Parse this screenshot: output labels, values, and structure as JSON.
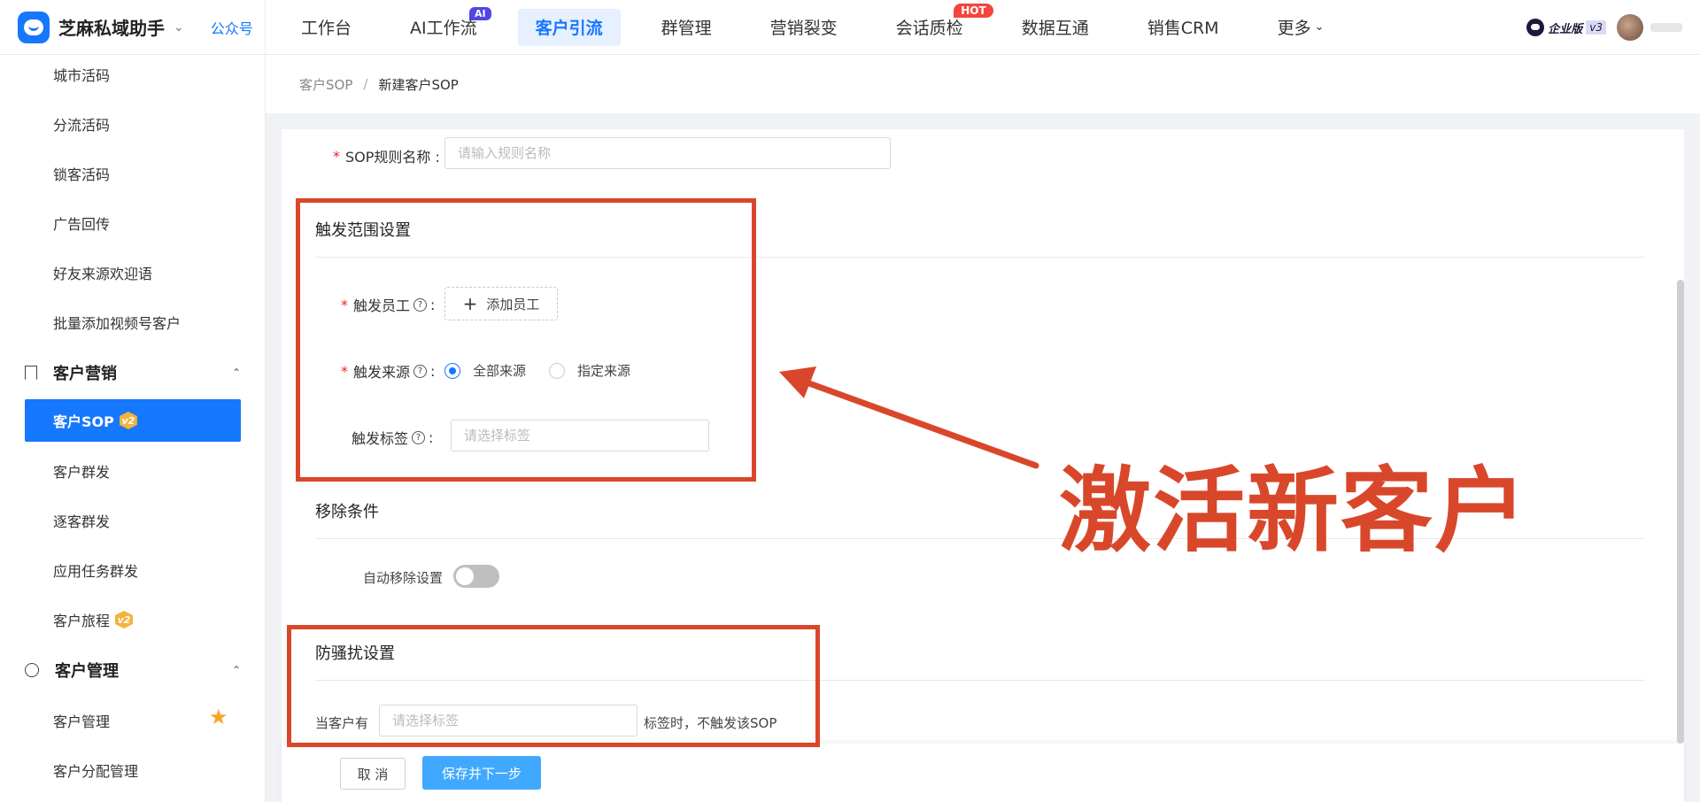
{
  "header": {
    "brand_name": "芝麻私域助手",
    "gzh": "公众号",
    "nav": [
      {
        "label": "工作台"
      },
      {
        "label": "AI工作流",
        "badge": "AI"
      },
      {
        "label": "客户引流",
        "active": true
      },
      {
        "label": "群管理"
      },
      {
        "label": "营销裂变"
      },
      {
        "label": "会话质检",
        "badge": "HOT"
      },
      {
        "label": "数据互通"
      },
      {
        "label": "销售CRM"
      },
      {
        "label": "更多"
      }
    ],
    "edition_label": "企业版",
    "edition_version": "v3"
  },
  "sidebar": {
    "items_top": [
      "城市活码",
      "分流活码",
      "锁客活码",
      "广告回传",
      "好友来源欢迎语",
      "批量添加视频号客户"
    ],
    "group_marketing": "客户营销",
    "active_item": "客户SOP",
    "v2": "v2",
    "items_marketing": [
      "客户群发",
      "逐客群发",
      "应用任务群发",
      "客户旅程"
    ],
    "group_manage": "客户管理",
    "items_manage": [
      "客户管理",
      "客户分配管理"
    ]
  },
  "breadcrumb": {
    "parent": "客户SOP",
    "separator": "/",
    "current": "新建客户SOP"
  },
  "form": {
    "rule_name_label": "SOP规则名称 :",
    "rule_name_placeholder": "请输入规则名称",
    "section_trigger": "触发范围设置",
    "trigger_staff_label": "触发员工",
    "add_staff": "添加员工",
    "trigger_source_label": "触发来源",
    "source_all": "全部来源",
    "source_specified": "指定来源",
    "trigger_tag_label": "触发标签",
    "tag_placeholder": "请选择标签",
    "section_remove": "移除条件",
    "auto_remove_label": "自动移除设置",
    "section_antidisturb": "防骚扰设置",
    "when_customer_has": "当客户有",
    "antidisturb_placeholder": "请选择标签",
    "antidisturb_suffix": "标签时，不触发该SOP",
    "colon": ":"
  },
  "footer": {
    "cancel": "取 消",
    "save_next": "保存并下一步"
  },
  "annotation": {
    "text": "激活新客户",
    "color": "#d9472b"
  },
  "colors": {
    "primary": "#1677ff",
    "save_button": "#40a9ff",
    "required": "#f5222d"
  }
}
